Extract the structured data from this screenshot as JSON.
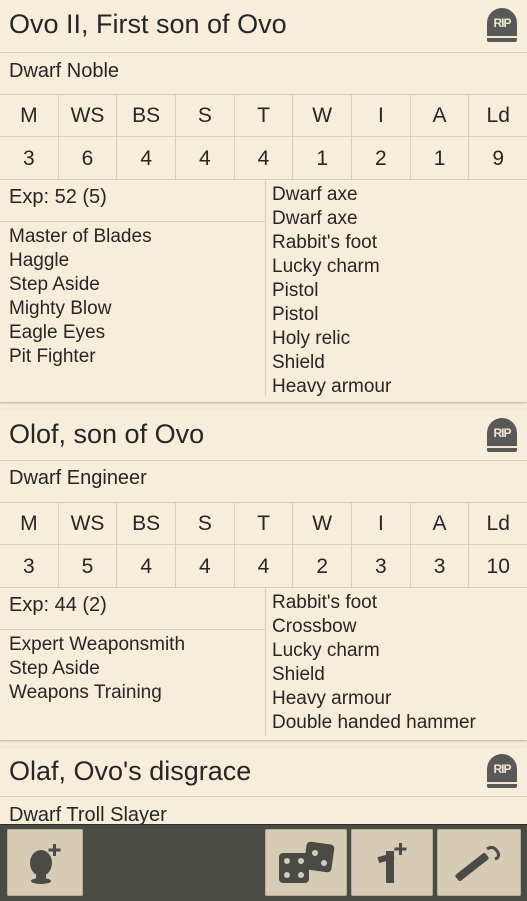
{
  "warriors": [
    {
      "name": "Ovo II, First son of Ovo",
      "type": "Dwarf Noble",
      "stat_labels": [
        "M",
        "WS",
        "BS",
        "S",
        "T",
        "W",
        "I",
        "A",
        "Ld"
      ],
      "stat_values": [
        "3",
        "6",
        "4",
        "4",
        "4",
        "1",
        "2",
        "1",
        "9"
      ],
      "exp": "Exp: 52 (5)",
      "skills": [
        "Master of Blades",
        "Haggle",
        "Step Aside",
        "Mighty Blow",
        "Eagle Eyes",
        "Pit Fighter"
      ],
      "equipment": [
        "Dwarf axe",
        "Dwarf axe",
        "Rabbit's foot",
        "Lucky charm",
        "Pistol",
        "Pistol",
        "Holy relic",
        "Shield",
        "Heavy armour"
      ],
      "rip_label": "RIP"
    },
    {
      "name": "Olof, son of Ovo",
      "type": "Dwarf Engineer",
      "stat_labels": [
        "M",
        "WS",
        "BS",
        "S",
        "T",
        "W",
        "I",
        "A",
        "Ld"
      ],
      "stat_values": [
        "3",
        "5",
        "4",
        "4",
        "4",
        "2",
        "3",
        "3",
        "10"
      ],
      "exp": "Exp: 44 (2)",
      "skills": [
        "Expert Weaponsmith",
        "Step Aside",
        "Weapons Training"
      ],
      "equipment": [
        "Rabbit's foot",
        "Crossbow",
        "Lucky charm",
        "Shield",
        "Heavy armour",
        "Double handed hammer"
      ],
      "rip_label": "RIP"
    },
    {
      "name": "Olaf, Ovo's disgrace",
      "type": "Dwarf Troll Slayer",
      "rip_label": "RIP"
    }
  ],
  "toolbar": {
    "buttons": [
      {
        "name": "add-hero",
        "icon": "add-hero-icon"
      },
      {
        "name": "dice",
        "icon": "dice-icon"
      },
      {
        "name": "add-henchman",
        "icon": "add-henchman-icon"
      },
      {
        "name": "flail",
        "icon": "flail-icon"
      }
    ]
  }
}
